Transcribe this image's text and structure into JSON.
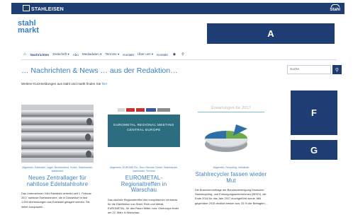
{
  "site": {
    "brand_left": "STAHLEISEN",
    "brand_right": "Stahl",
    "logo_line1": "stahl",
    "logo_line2": "markt"
  },
  "placeholders": {
    "a": "A",
    "f": "F",
    "g": "G"
  },
  "nav": {
    "items": [
      {
        "label": "Nachrichten",
        "active": true
      },
      {
        "label": "Zeitschrift ▾",
        "active": false
      },
      {
        "label": "Abo",
        "active": false
      },
      {
        "label": "Mediadaten ▾",
        "active": false
      },
      {
        "label": "Termine ▾",
        "active": false
      },
      {
        "label": "Kontakt",
        "active": false
      },
      {
        "label": "Über uns ▾",
        "active": false
      },
      {
        "label": "Kontakt",
        "active": false
      }
    ]
  },
  "page": {
    "heading": "… Nachrichten & News … aus der Redaktion…",
    "intro_text": "Weitere Kurzmeldungen aus stahl und markt finden Sie",
    "intro_link": "hier"
  },
  "search": {
    "placeholder": "Suche"
  },
  "icons": {
    "home": "home-icon",
    "lock": "lock-icon",
    "search": "search-icon",
    "brand_mark": "stahleisen-logo-icon",
    "stahl_mark": "stahl-logo-icon"
  },
  "articles": [
    {
      "categories": "Allgemein, Edelstahl, Lager, Nichtrostend, Rohre, Stahlhandel, stahlmarkt",
      "title": "Neues Zentrallager für nahtlose Edelstahlrohre",
      "body": "Das Unternehmen Vöhl Edelstahl vertreibt seit 1. Februar 2017 nahtlose Edelstahlrohre, die in Düsseldorf in fast 1.000 Abmessungen aus Edelstahl gelagert werden. Sie liefert europaweit..."
    },
    {
      "image_line1": "EUROMETAL REGIONAL MEETING",
      "image_line2": "CENTRAL EUROPE",
      "categories": "Allgemein, EUROMETAL, Euro Service Center, Stahlhandel, stahlmarkt, Termine",
      "title": "EUROMETAL-Regionaltreffen in Warschau",
      "body": "Das nächste Regionaltreffen des europäischen Verbands für die Distribution von Stahl, Rohr und Metall, EUROMETAL, für den Raum Mittel- bzw. Osteuropa findet am 22. März in Warschau..."
    },
    {
      "chart_title": "Erwartungen für 2017",
      "categories": "Allgemein, Recycling, Verbände",
      "title": "Stahlrecycler fassen wieder Mut",
      "body": "Die Branchenumfrage der Bundesvereinigung Deutscher Stahlrecycling- und Entsorgungsunternehmen (BDSV), die Ende 2016 für das Jahr 2017 durchgeführt wurde, fällt gegenüber 2015 deutlich besser aus: 33 % der Befragten..."
    }
  ],
  "colors": {
    "navy": "#1d3d73",
    "accent_blue": "#3a7fc1",
    "teal_banner": "#2c6e80",
    "chart_blue": "#2f6fa7",
    "chart_green": "#6fa84a"
  }
}
